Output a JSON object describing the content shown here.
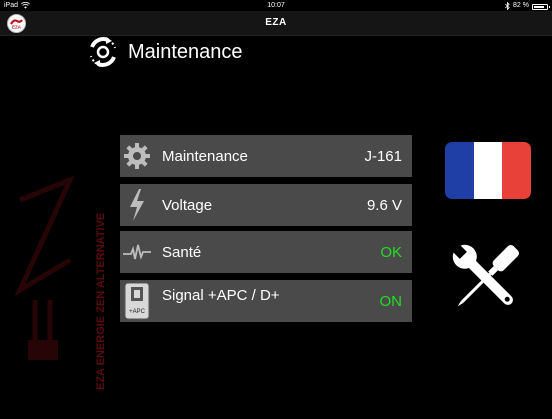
{
  "status_bar": {
    "device": "iPad",
    "time": "10:07",
    "battery_text": "82 %",
    "battery_level": 0.82,
    "icons": [
      "wifi-icon",
      "bluetooth-icon",
      "battery-icon"
    ]
  },
  "nav": {
    "title": "EZA",
    "logo_text": "EZA"
  },
  "header": {
    "title": "Maintenance",
    "icon": "maintenance-cycle-icon"
  },
  "watermark": {
    "text": "EZA ENERGIE ZEN ALTERNATIVE"
  },
  "rows": [
    {
      "icon": "gear-icon",
      "label": "Maintenance",
      "value": "J-161",
      "value_color": "#ffffff"
    },
    {
      "icon": "lightning-icon",
      "label": "Voltage",
      "value": "9.6 V",
      "value_color": "#ffffff"
    },
    {
      "icon": "heartbeat-icon",
      "label": "Santé",
      "value": "OK",
      "value_color": "#22dd22"
    },
    {
      "icon": "apc-signal-icon",
      "icon_text": "+APC",
      "label": "Signal +APC / D+",
      "value": "ON",
      "value_color": "#22dd22"
    }
  ],
  "flag": {
    "name": "france-flag",
    "colors": [
      "#1f3fa6",
      "#ffffff",
      "#e8413a"
    ]
  },
  "tools_icon": "wrench-screwdriver-icon",
  "colors": {
    "row_bg": "#4a4a4a",
    "ok_green": "#22dd22",
    "background": "#000000"
  }
}
